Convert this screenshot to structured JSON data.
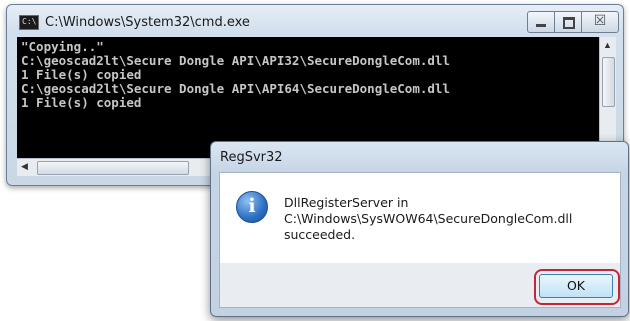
{
  "cmd_window": {
    "title": "C:\\Windows\\System32\\cmd.exe",
    "icon_text": "C:\\",
    "close_glyph": "☒",
    "console_lines": [
      "\"Copying..\"",
      "C:\\geoscad2lt\\Secure Dongle API\\API32\\SecureDongleCom.dll",
      "1 File(s) copied",
      "C:\\geoscad2lt\\Secure Dongle API\\API64\\SecureDongleCom.dll",
      "1 File(s) copied"
    ],
    "scroll_up_glyph": "▲",
    "scroll_left_glyph": "◀"
  },
  "dialog": {
    "title": "RegSvr32",
    "info_glyph": "i",
    "message_lines": [
      "DllRegisterServer in",
      "C:\\Windows\\SysWOW64\\SecureDongleCom.dll",
      "succeeded."
    ],
    "ok_label": "OK"
  },
  "colors": {
    "console_bg": "#000000",
    "console_text": "#c6c6c6",
    "highlight": "#c0283a"
  }
}
